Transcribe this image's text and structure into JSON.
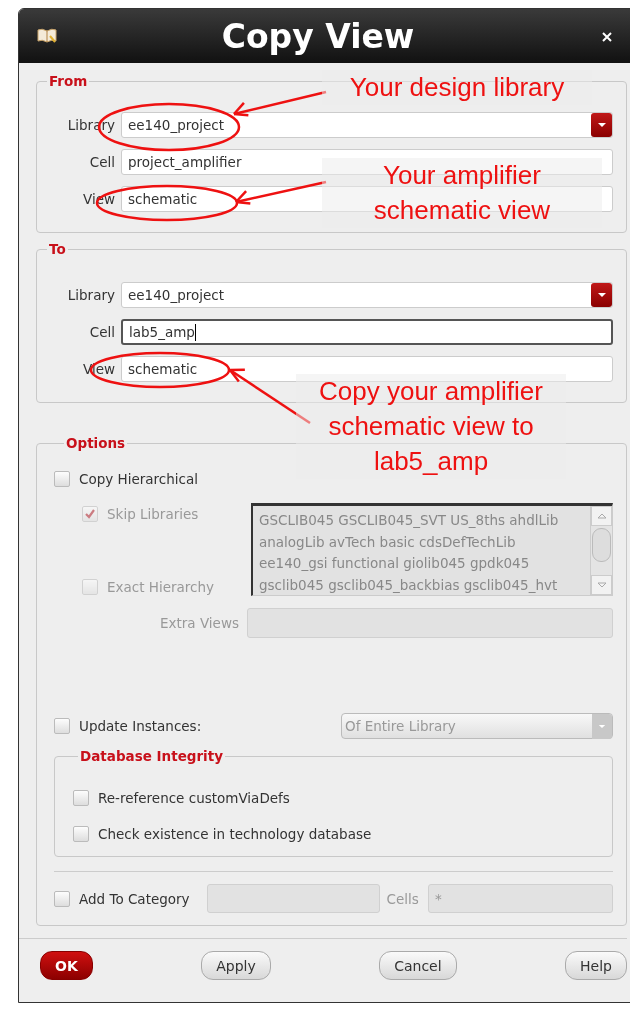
{
  "window": {
    "title": "Copy View"
  },
  "from": {
    "legend": "From",
    "fields": [
      {
        "label": "Library",
        "value": "ee140_project",
        "kind": "combo",
        "focused": false
      },
      {
        "label": "Cell",
        "value": "project_amplifier",
        "kind": "text",
        "focused": false
      },
      {
        "label": "View",
        "value": "schematic",
        "kind": "text",
        "focused": false
      }
    ]
  },
  "to": {
    "legend": "To",
    "fields": [
      {
        "label": "Library",
        "value": "ee140_project",
        "kind": "combo",
        "focused": false
      },
      {
        "label": "Cell",
        "value": "lab5_amp",
        "kind": "text",
        "focused": true
      },
      {
        "label": "View",
        "value": "schematic",
        "kind": "text",
        "focused": false
      }
    ]
  },
  "options": {
    "legend": "Options",
    "copy_hierarchical": {
      "label": "Copy Hierarchical",
      "checked": false,
      "disabled": false
    },
    "skip_libraries": {
      "label": "Skip Libraries",
      "checked": true,
      "disabled": true
    },
    "libraries": [
      "GSCLIB045 GSCLIB045_SVT US_8ths ahdlLib",
      "analogLib avTech basic cdsDefTechLib",
      "ee140_gsi functional giolib045 gpdk045",
      "gsclib045 gsclib045_backbias gsclib045_hvt"
    ],
    "exact_hierarchy": {
      "label": "Exact Hierarchy",
      "checked": false,
      "disabled": true
    },
    "extra_views": {
      "label": "Extra Views",
      "disabled": true
    },
    "update_instances": {
      "label": "Update Instances:",
      "checked": false,
      "disabled": false,
      "scope": "Of Entire Library",
      "scope_disabled": true
    },
    "database_integrity": {
      "legend": "Database Integrity",
      "checkboxes": [
        {
          "label": "Re-reference customViaDefs",
          "checked": false,
          "disabled": false
        },
        {
          "label": "Check existence in technology database",
          "checked": false,
          "disabled": false
        }
      ]
    },
    "add_to_category": {
      "label": "Add To Category",
      "checked": false,
      "disabled": false,
      "cells_label": "Cells",
      "cells_value": "*"
    }
  },
  "buttons": [
    {
      "label": "OK",
      "default": true
    },
    {
      "label": "Apply",
      "default": false
    },
    {
      "label": "Cancel",
      "default": false
    },
    {
      "label": "Help",
      "default": false
    }
  ],
  "annotations": [
    {
      "lines": [
        "Your design library"
      ]
    },
    {
      "lines": [
        "Your amplifier",
        "schematic view"
      ]
    },
    {
      "lines": [
        "Copy your amplifier",
        "schematic view to",
        "lab5_amp"
      ]
    }
  ]
}
